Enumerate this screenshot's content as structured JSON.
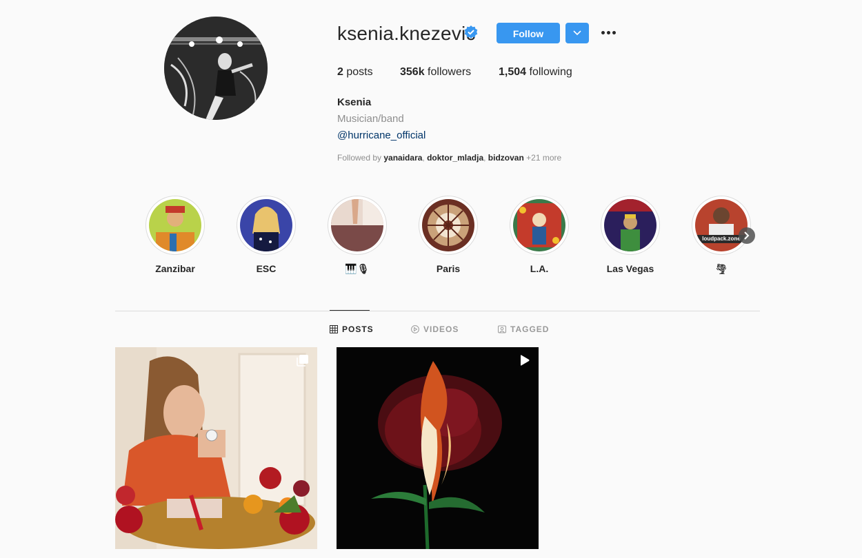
{
  "profile": {
    "username": "ksenia.knezevic",
    "follow_label": "Follow",
    "stats": [
      {
        "count": "2",
        "label": "posts"
      },
      {
        "count": "356k",
        "label": "followers"
      },
      {
        "count": "1,504",
        "label": "following"
      }
    ],
    "full_name": "Ksenia",
    "category": "Musician/band",
    "link": "@hurricane_official",
    "followed_by_prefix": "Followed by",
    "followed_by_users": [
      "yanaidara",
      "doktor_mladja",
      "bidzovan"
    ],
    "followed_by_more": "+21 more"
  },
  "highlights": [
    {
      "label": "Zanzibar"
    },
    {
      "label": "ESC"
    },
    {
      "label": "🎹🎙"
    },
    {
      "label": "Paris"
    },
    {
      "label": "L.A."
    },
    {
      "label": "Las Vegas"
    },
    {
      "label": "🌪"
    }
  ],
  "highlight_thumb_text": "loudpack.zone",
  "tabs": [
    {
      "label": "POSTS",
      "icon": "grid-icon",
      "active": true
    },
    {
      "label": "VIDEOS",
      "icon": "play-circle-icon",
      "active": false
    },
    {
      "label": "TAGGED",
      "icon": "tag-icon",
      "active": false
    }
  ],
  "posts": [
    {
      "type": "carousel",
      "icon": "carousel-icon"
    },
    {
      "type": "video",
      "icon": "play-icon"
    }
  ],
  "colors": {
    "accent": "#3897f0",
    "text": "#262626",
    "muted": "#8e8e8e",
    "link": "#003569",
    "background": "#fafafa"
  }
}
